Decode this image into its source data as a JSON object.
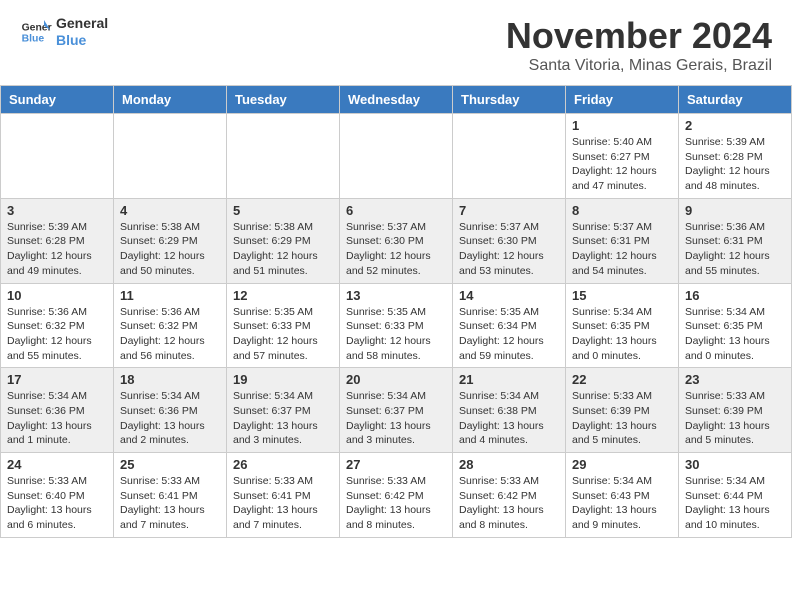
{
  "header": {
    "logo_line1": "General",
    "logo_line2": "Blue",
    "month": "November 2024",
    "location": "Santa Vitoria, Minas Gerais, Brazil"
  },
  "days_of_week": [
    "Sunday",
    "Monday",
    "Tuesday",
    "Wednesday",
    "Thursday",
    "Friday",
    "Saturday"
  ],
  "weeks": [
    [
      {
        "day": "",
        "info": ""
      },
      {
        "day": "",
        "info": ""
      },
      {
        "day": "",
        "info": ""
      },
      {
        "day": "",
        "info": ""
      },
      {
        "day": "",
        "info": ""
      },
      {
        "day": "1",
        "info": "Sunrise: 5:40 AM\nSunset: 6:27 PM\nDaylight: 12 hours\nand 47 minutes."
      },
      {
        "day": "2",
        "info": "Sunrise: 5:39 AM\nSunset: 6:28 PM\nDaylight: 12 hours\nand 48 minutes."
      }
    ],
    [
      {
        "day": "3",
        "info": "Sunrise: 5:39 AM\nSunset: 6:28 PM\nDaylight: 12 hours\nand 49 minutes."
      },
      {
        "day": "4",
        "info": "Sunrise: 5:38 AM\nSunset: 6:29 PM\nDaylight: 12 hours\nand 50 minutes."
      },
      {
        "day": "5",
        "info": "Sunrise: 5:38 AM\nSunset: 6:29 PM\nDaylight: 12 hours\nand 51 minutes."
      },
      {
        "day": "6",
        "info": "Sunrise: 5:37 AM\nSunset: 6:30 PM\nDaylight: 12 hours\nand 52 minutes."
      },
      {
        "day": "7",
        "info": "Sunrise: 5:37 AM\nSunset: 6:30 PM\nDaylight: 12 hours\nand 53 minutes."
      },
      {
        "day": "8",
        "info": "Sunrise: 5:37 AM\nSunset: 6:31 PM\nDaylight: 12 hours\nand 54 minutes."
      },
      {
        "day": "9",
        "info": "Sunrise: 5:36 AM\nSunset: 6:31 PM\nDaylight: 12 hours\nand 55 minutes."
      }
    ],
    [
      {
        "day": "10",
        "info": "Sunrise: 5:36 AM\nSunset: 6:32 PM\nDaylight: 12 hours\nand 55 minutes."
      },
      {
        "day": "11",
        "info": "Sunrise: 5:36 AM\nSunset: 6:32 PM\nDaylight: 12 hours\nand 56 minutes."
      },
      {
        "day": "12",
        "info": "Sunrise: 5:35 AM\nSunset: 6:33 PM\nDaylight: 12 hours\nand 57 minutes."
      },
      {
        "day": "13",
        "info": "Sunrise: 5:35 AM\nSunset: 6:33 PM\nDaylight: 12 hours\nand 58 minutes."
      },
      {
        "day": "14",
        "info": "Sunrise: 5:35 AM\nSunset: 6:34 PM\nDaylight: 12 hours\nand 59 minutes."
      },
      {
        "day": "15",
        "info": "Sunrise: 5:34 AM\nSunset: 6:35 PM\nDaylight: 13 hours\nand 0 minutes."
      },
      {
        "day": "16",
        "info": "Sunrise: 5:34 AM\nSunset: 6:35 PM\nDaylight: 13 hours\nand 0 minutes."
      }
    ],
    [
      {
        "day": "17",
        "info": "Sunrise: 5:34 AM\nSunset: 6:36 PM\nDaylight: 13 hours\nand 1 minute."
      },
      {
        "day": "18",
        "info": "Sunrise: 5:34 AM\nSunset: 6:36 PM\nDaylight: 13 hours\nand 2 minutes."
      },
      {
        "day": "19",
        "info": "Sunrise: 5:34 AM\nSunset: 6:37 PM\nDaylight: 13 hours\nand 3 minutes."
      },
      {
        "day": "20",
        "info": "Sunrise: 5:34 AM\nSunset: 6:37 PM\nDaylight: 13 hours\nand 3 minutes."
      },
      {
        "day": "21",
        "info": "Sunrise: 5:34 AM\nSunset: 6:38 PM\nDaylight: 13 hours\nand 4 minutes."
      },
      {
        "day": "22",
        "info": "Sunrise: 5:33 AM\nSunset: 6:39 PM\nDaylight: 13 hours\nand 5 minutes."
      },
      {
        "day": "23",
        "info": "Sunrise: 5:33 AM\nSunset: 6:39 PM\nDaylight: 13 hours\nand 5 minutes."
      }
    ],
    [
      {
        "day": "24",
        "info": "Sunrise: 5:33 AM\nSunset: 6:40 PM\nDaylight: 13 hours\nand 6 minutes."
      },
      {
        "day": "25",
        "info": "Sunrise: 5:33 AM\nSunset: 6:41 PM\nDaylight: 13 hours\nand 7 minutes."
      },
      {
        "day": "26",
        "info": "Sunrise: 5:33 AM\nSunset: 6:41 PM\nDaylight: 13 hours\nand 7 minutes."
      },
      {
        "day": "27",
        "info": "Sunrise: 5:33 AM\nSunset: 6:42 PM\nDaylight: 13 hours\nand 8 minutes."
      },
      {
        "day": "28",
        "info": "Sunrise: 5:33 AM\nSunset: 6:42 PM\nDaylight: 13 hours\nand 8 minutes."
      },
      {
        "day": "29",
        "info": "Sunrise: 5:34 AM\nSunset: 6:43 PM\nDaylight: 13 hours\nand 9 minutes."
      },
      {
        "day": "30",
        "info": "Sunrise: 5:34 AM\nSunset: 6:44 PM\nDaylight: 13 hours\nand 10 minutes."
      }
    ]
  ]
}
